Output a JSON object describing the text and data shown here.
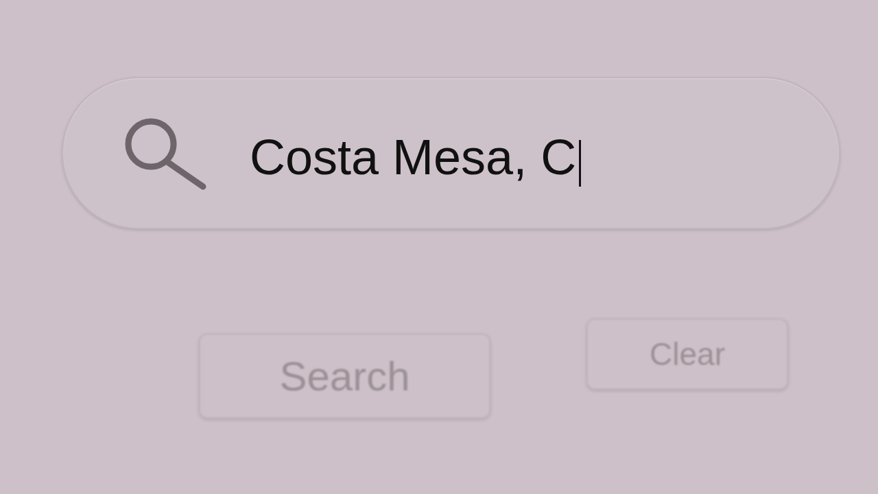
{
  "search": {
    "value": "Costa Mesa, C",
    "focused": true
  },
  "buttons": [
    {
      "label": "Search"
    },
    {
      "label": "Clear"
    }
  ]
}
